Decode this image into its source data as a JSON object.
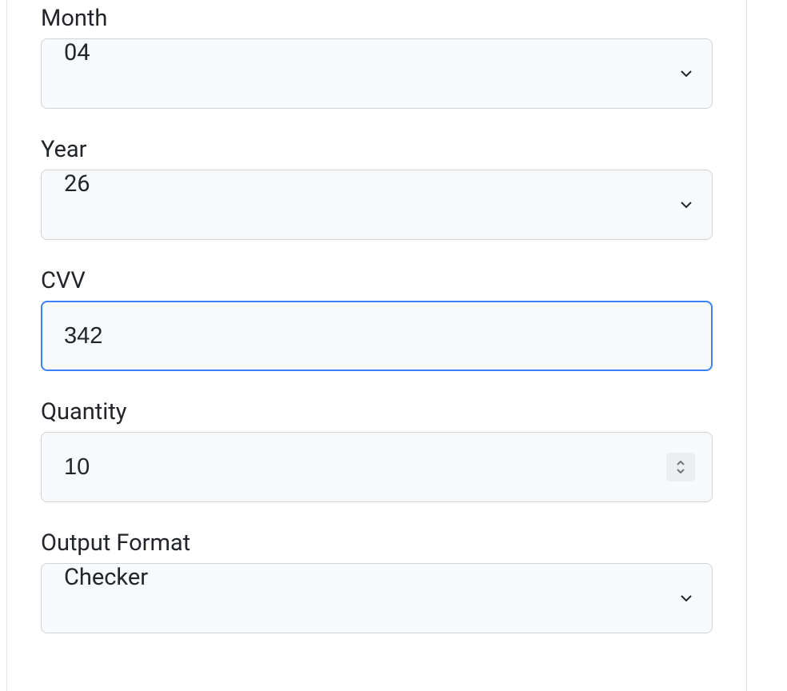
{
  "fields": {
    "month": {
      "label": "Month",
      "value": "04"
    },
    "year": {
      "label": "Year",
      "value": "26"
    },
    "cvv": {
      "label": "CVV",
      "value": "342"
    },
    "quantity": {
      "label": "Quantity",
      "value": "10"
    },
    "output_format": {
      "label": "Output Format",
      "value": "Checker"
    }
  }
}
